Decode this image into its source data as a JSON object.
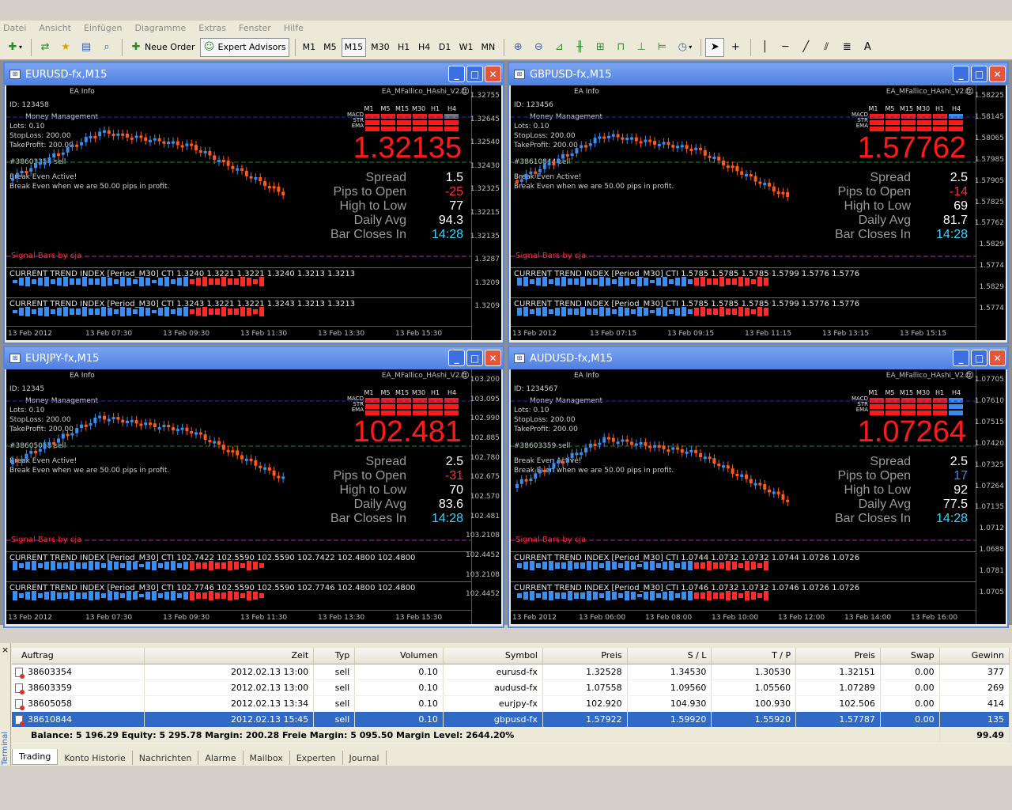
{
  "menu": [
    "Datei",
    "Ansicht",
    "Einfügen",
    "Diagramme",
    "Extras",
    "Fenster",
    "Hilfe"
  ],
  "toolbar": {
    "neue_order": "Neue Order",
    "expert_advisors": "Expert Advisors",
    "timeframes": [
      "M1",
      "M5",
      "M15",
      "M30",
      "H1",
      "H4",
      "D1",
      "W1",
      "MN"
    ],
    "active_tf": "M15",
    "text_tool": "A"
  },
  "charts": [
    {
      "title": "EURUSD-fx,M15",
      "ea_name": "EA_MFallico_HAshi_V2.0",
      "price": "1.32135",
      "ea_info": "EA Info",
      "id": "ID: 123458",
      "mm": "Money Management",
      "lots": "Lots: 0.10",
      "sl": "StopLoss: 200.00",
      "tp": "TakeProfit: 200.00",
      "order": "#38603354 sell",
      "be1": "Break Even Active!",
      "be2": "Break Even when we are 50.00 pips in profit.",
      "signal": "Signal Bars by cja",
      "spread": "1.5",
      "pips": "-25",
      "hl": "77",
      "avg": "94.3",
      "bar": "14:28",
      "axis": [
        "1.32755",
        "1.32645",
        "1.32540",
        "1.32430",
        "1.32325",
        "1.32215",
        "1.32135",
        "1.3287",
        "1.3209",
        "1.3209"
      ],
      "times": [
        "13 Feb 2012",
        "13 Feb 07:30",
        "13 Feb 09:30",
        "13 Feb 11:30",
        "13 Feb 13:30",
        "13 Feb 15:30"
      ],
      "cti1": "CURRENT TREND INDEX [Period_M30] CTI 1.3240 1.3221 1.3221 1.3240 1.3213 1.3213",
      "cti2": "CURRENT TREND INDEX [Period_M30] CTI 1.3243 1.3221 1.3221 1.3243 1.3213 1.3213"
    },
    {
      "title": "GBPUSD-fx,M15",
      "ea_name": "EA_MFallico_HAshi_V2.0",
      "price": "1.57762",
      "ea_info": "EA Info",
      "id": "ID: 123456",
      "mm": "Money Management",
      "lots": "Lots: 0.10",
      "sl": "StopLoss: 200.00",
      "tp": "TakeProfit: 200.00",
      "order": "#38610844 sell",
      "be1": "Break Even Active!",
      "be2": "Break Even when we are 50.00 pips in profit.",
      "signal": "Signal Bars by cja",
      "spread": "2.5",
      "pips": "-14",
      "hl": "69",
      "avg": "81.7",
      "bar": "14:28",
      "axis": [
        "1.58225",
        "1.58145",
        "1.58065",
        "1.57985",
        "1.57905",
        "1.57825",
        "1.57762",
        "1.5829",
        "1.5774",
        "1.5829",
        "1.5774"
      ],
      "times": [
        "13 Feb 2012",
        "13 Feb 07:15",
        "13 Feb 09:15",
        "13 Feb 11:15",
        "13 Feb 13:15",
        "13 Feb 15:15"
      ],
      "cti1": "CURRENT TREND INDEX [Period_M30] CTI 1.5785 1.5785 1.5785 1.5799 1.5776 1.5776",
      "cti2": "CURRENT TREND INDEX [Period_M30] CTI 1.5785 1.5785 1.5785 1.5799 1.5776 1.5776"
    },
    {
      "title": "EURJPY-fx,M15",
      "ea_name": "EA_MFallico_HAshi_V2.0",
      "price": "102.481",
      "ea_info": "EA Info",
      "id": "ID: 12345",
      "mm": "Money Management",
      "lots": "Lots: 0.10",
      "sl": "StopLoss: 200.00",
      "tp": "TakeProfit: 200.00",
      "order": "#38605058 sell",
      "be1": "Break Even Active!",
      "be2": "Break Even when we are 50.00 pips in profit.",
      "signal": "Signal Bars by cja",
      "spread": "2.5",
      "pips": "-31",
      "hl": "70",
      "avg": "83.6",
      "bar": "14:28",
      "axis": [
        "103.200",
        "103.095",
        "102.990",
        "102.885",
        "102.780",
        "102.675",
        "102.570",
        "102.481",
        "103.2108",
        "102.4452",
        "103.2108",
        "102.4452"
      ],
      "times": [
        "13 Feb 2012",
        "13 Feb 07:30",
        "13 Feb 09:30",
        "13 Feb 11:30",
        "13 Feb 13:30",
        "13 Feb 15:30"
      ],
      "cti1": "CURRENT TREND INDEX [Period_M30] CTI 102.7422 102.5590 102.5590 102.7422 102.4800 102.4800",
      "cti2": "CURRENT TREND INDEX [Period_M30] CTI 102.7746 102.5590 102.5590 102.7746 102.4800 102.4800"
    },
    {
      "title": "AUDUSD-fx,M15",
      "ea_name": "EA_MFallico_HAshi_V2.0",
      "price": "1.07264",
      "ea_info": "EA Info",
      "id": "ID: 1234567",
      "mm": "Money Management",
      "lots": "Lots: 0.10",
      "sl": "StopLoss: 200.00",
      "tp": "TakeProfit: 200.00",
      "order": "#38603359 sell",
      "be1": "Break Even Active!",
      "be2": "Break Even when we are 50.00 pips in profit.",
      "signal": "Signal Bars by cja",
      "spread": "2.5",
      "pips": "17",
      "hl": "92",
      "avg": "77.5",
      "bar": "14:28",
      "axis": [
        "1.07705",
        "1.07610",
        "1.07515",
        "1.07420",
        "1.07325",
        "1.07264",
        "1.07135",
        "1.0712",
        "1.0688",
        "1.0781",
        "1.0705"
      ],
      "times": [
        "13 Feb 2012",
        "13 Feb 06:00",
        "13 Feb 08:00",
        "13 Feb 10:00",
        "13 Feb 12:00",
        "13 Feb 14:00",
        "13 Feb 16:00"
      ],
      "cti1": "CURRENT TREND INDEX [Period_M30] CTI 1.0744 1.0732 1.0732 1.0744 1.0726 1.0726",
      "cti2": "CURRENT TREND INDEX [Period_M30] CTI 1.0746 1.0732 1.0732 1.0746 1.0726 1.0726"
    }
  ],
  "info_labels": {
    "spread": "Spread",
    "pips": "Pips to Open",
    "hl": "High to Low",
    "avg": "Daily Avg",
    "bar": "Bar Closes In"
  },
  "tf_head": [
    "M1",
    "M5",
    "M15",
    "M30",
    "H1",
    "H4"
  ],
  "grid_labels": [
    "MACD",
    "STR",
    "EMA"
  ],
  "terminal": {
    "side_label": "Terminal",
    "close": "×",
    "columns": [
      "Auftrag",
      "Zeit",
      "Typ",
      "Volumen",
      "Symbol",
      "Preis",
      "S / L",
      "T / P",
      "Preis",
      "Swap",
      "Gewinn"
    ],
    "sort_mark": "/",
    "rows": [
      [
        "38603354",
        "2012.02.13 13:00",
        "sell",
        "0.10",
        "eurusd-fx",
        "1.32528",
        "1.34530",
        "1.30530",
        "1.32151",
        "0.00",
        "377"
      ],
      [
        "38603359",
        "2012.02.13 13:00",
        "sell",
        "0.10",
        "audusd-fx",
        "1.07558",
        "1.09560",
        "1.05560",
        "1.07289",
        "0.00",
        "269"
      ],
      [
        "38605058",
        "2012.02.13 13:34",
        "sell",
        "0.10",
        "eurjpy-fx",
        "102.920",
        "104.930",
        "100.930",
        "102.506",
        "0.00",
        "414"
      ],
      [
        "38610844",
        "2012.02.13 15:45",
        "sell",
        "0.10",
        "gbpusd-fx",
        "1.57922",
        "1.59920",
        "1.55920",
        "1.57787",
        "0.00",
        "135"
      ]
    ],
    "balance": "Balance: 5 196.29  Equity: 5 295.78  Margin: 200.28  Freie Margin: 5 095.50  Margin Level: 2644.20%",
    "total": "99.49",
    "tabs": [
      "Trading",
      "Konto Historie",
      "Nachrichten",
      "Alarme",
      "Mailbox",
      "Experten",
      "Journal"
    ]
  }
}
